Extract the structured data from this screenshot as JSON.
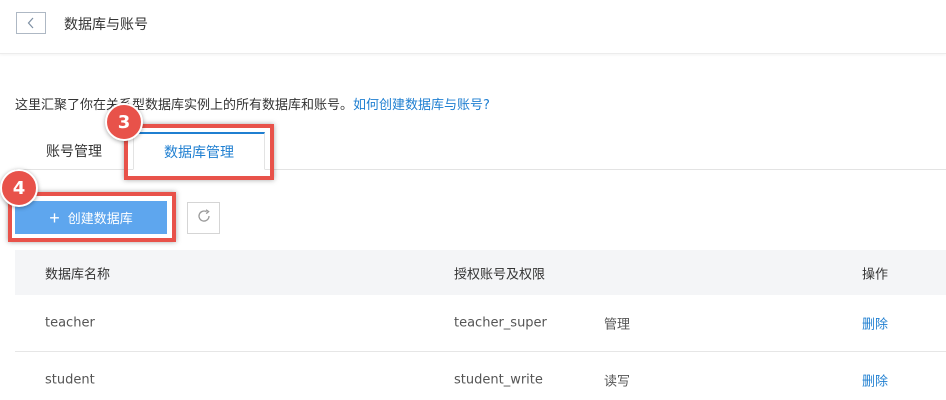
{
  "header": {
    "title": "数据库与账号"
  },
  "description": {
    "text_before": "这里汇聚了你在关系型数据库实例上的所有数据库和账号。",
    "help_link": "如何创建数据库与账号?"
  },
  "tabs": [
    {
      "label": "账号管理",
      "active": false
    },
    {
      "label": "数据库管理",
      "active": true
    }
  ],
  "toolbar": {
    "create_label": "创建数据库"
  },
  "table": {
    "headers": {
      "name": "数据库名称",
      "accounts": "授权账号及权限",
      "actions": "操作"
    },
    "rows": [
      {
        "name": "teacher",
        "account": "teacher_super",
        "permission": "管理",
        "action": "删除"
      },
      {
        "name": "student",
        "account": "student_write",
        "permission": "读写",
        "action": "删除"
      }
    ]
  },
  "annotations": {
    "step_tab": "3",
    "step_create": "4",
    "highlight_color": "#e8524a"
  },
  "colors": {
    "accent": "#1f7fd1",
    "primary_button": "#5ea6ee"
  }
}
